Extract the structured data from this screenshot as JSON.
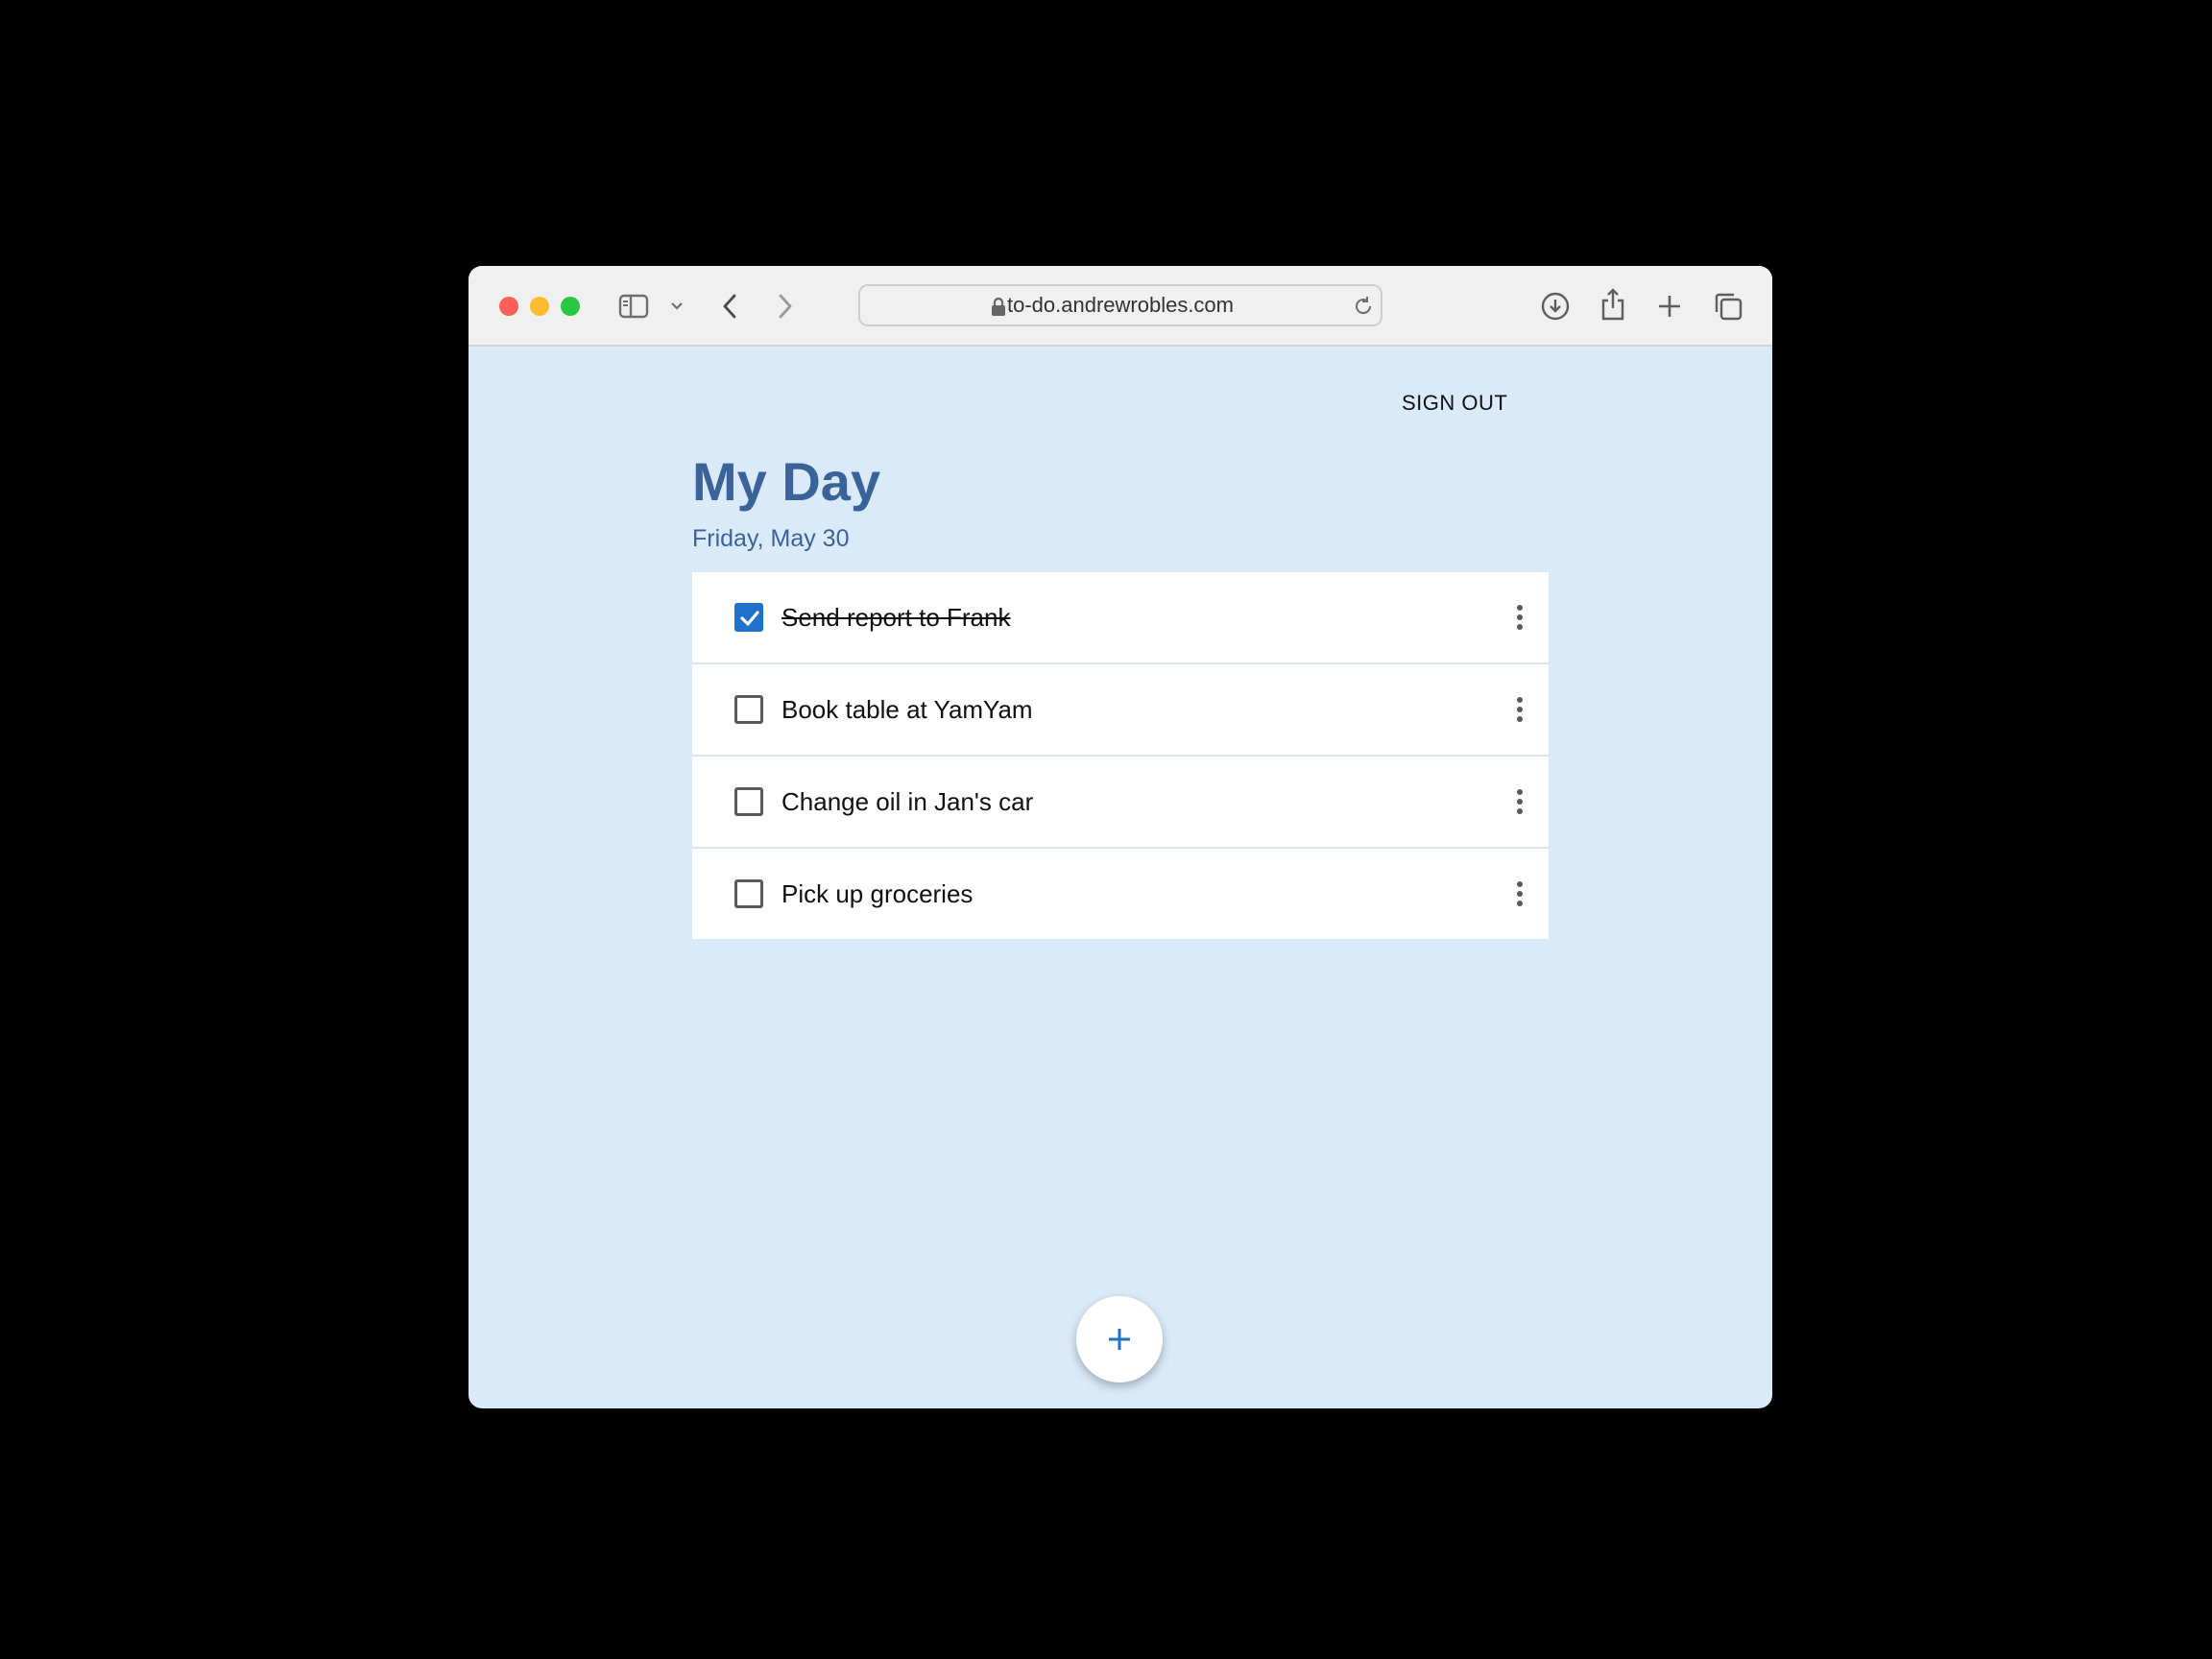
{
  "browser": {
    "url": "to-do.andrewrobles.com",
    "icons": [
      "sidebar-icon",
      "chevron-down-icon",
      "back-icon",
      "forward-icon",
      "lock-icon",
      "reload-icon",
      "download-icon",
      "share-icon",
      "new-tab-icon",
      "tabs-overview-icon"
    ]
  },
  "header": {
    "sign_out_label": "SIGN OUT"
  },
  "page": {
    "title": "My Day",
    "date": "Friday, May 30"
  },
  "tasks": [
    {
      "label": "Send report to Frank",
      "completed": true
    },
    {
      "label": "Book table at YamYam",
      "completed": false
    },
    {
      "label": "Change oil in Jan's car",
      "completed": false
    },
    {
      "label": "Pick up groceries",
      "completed": false
    }
  ],
  "fab": {
    "label": "+",
    "icon": "plus-icon"
  },
  "colors": {
    "page_background": "#dbeaf8",
    "title": "#3a6499",
    "accent": "#1f72c8",
    "card": "#ffffff"
  }
}
